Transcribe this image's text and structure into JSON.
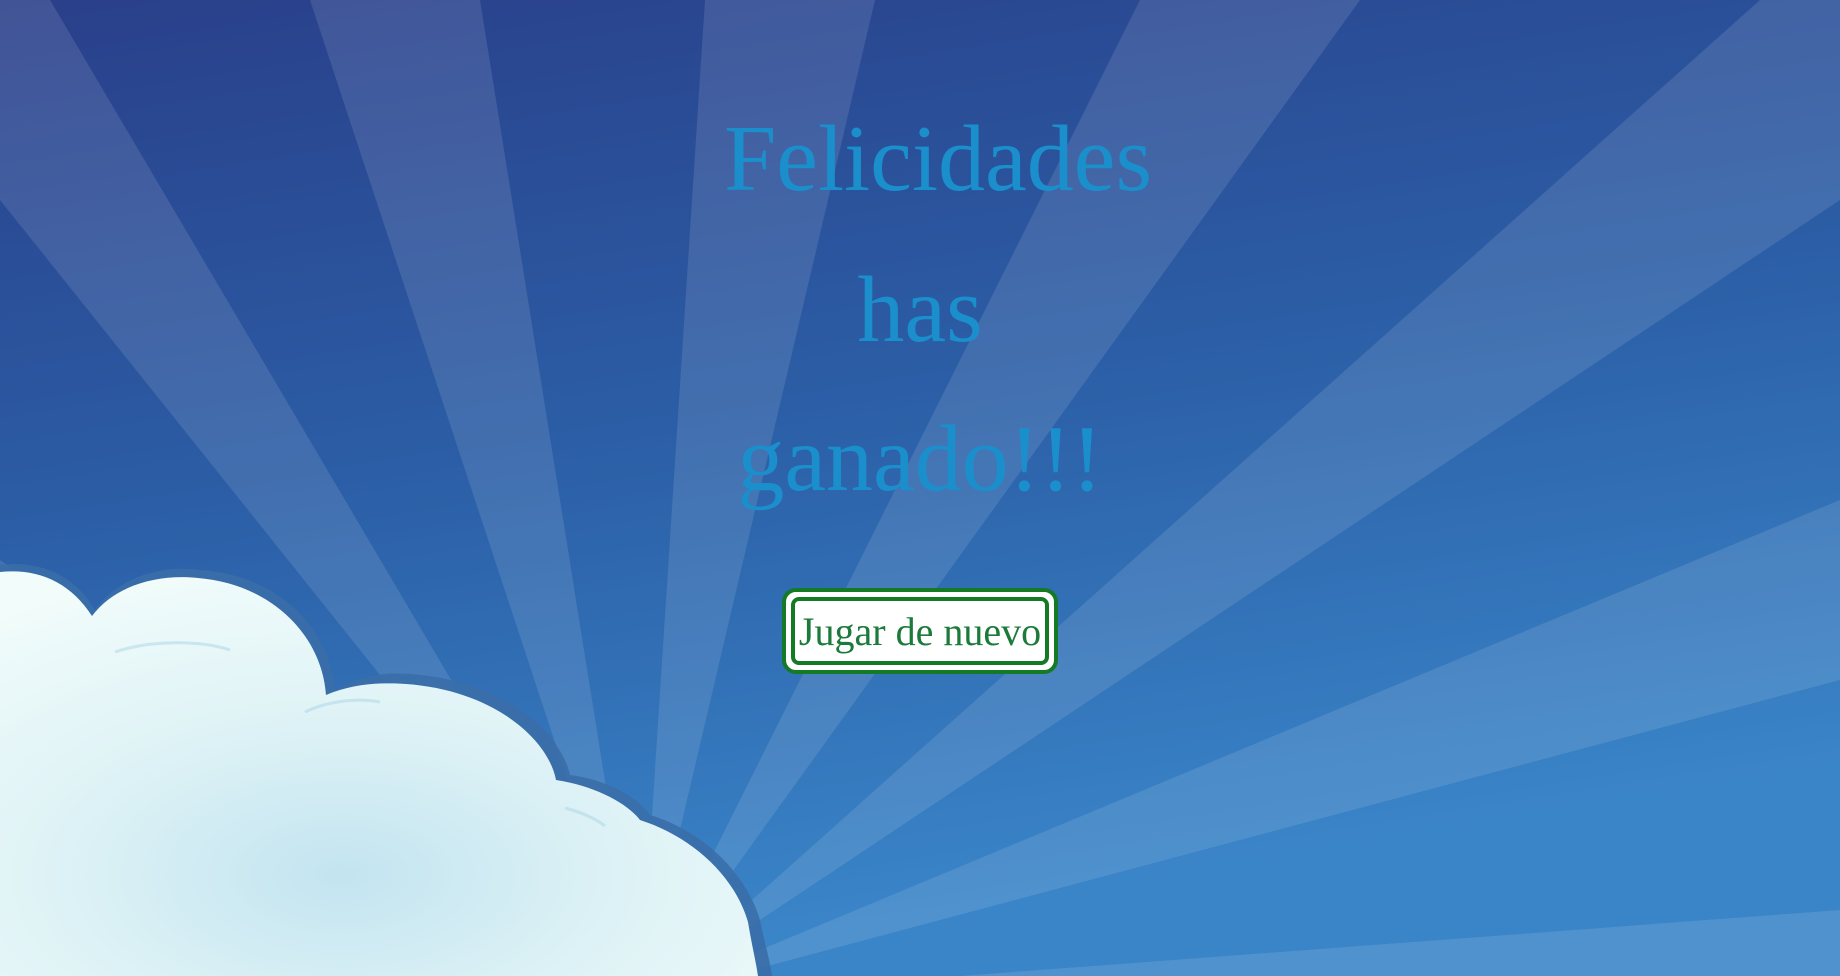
{
  "message": {
    "line1": "Felicidades",
    "line2": "has",
    "line3": "ganado!!!"
  },
  "play_again": {
    "label": "Jugar de nuevo"
  },
  "colors": {
    "sky_top": "#233f8a",
    "sky_bottom": "#3a82c6",
    "message_text": "#1a8fcc",
    "button_border": "#157a26",
    "button_text": "#1c7a3a",
    "cloud": "#e6f7f9"
  },
  "icons": {
    "background": "sunburst-rays",
    "cloud": "cloud-illustration"
  }
}
